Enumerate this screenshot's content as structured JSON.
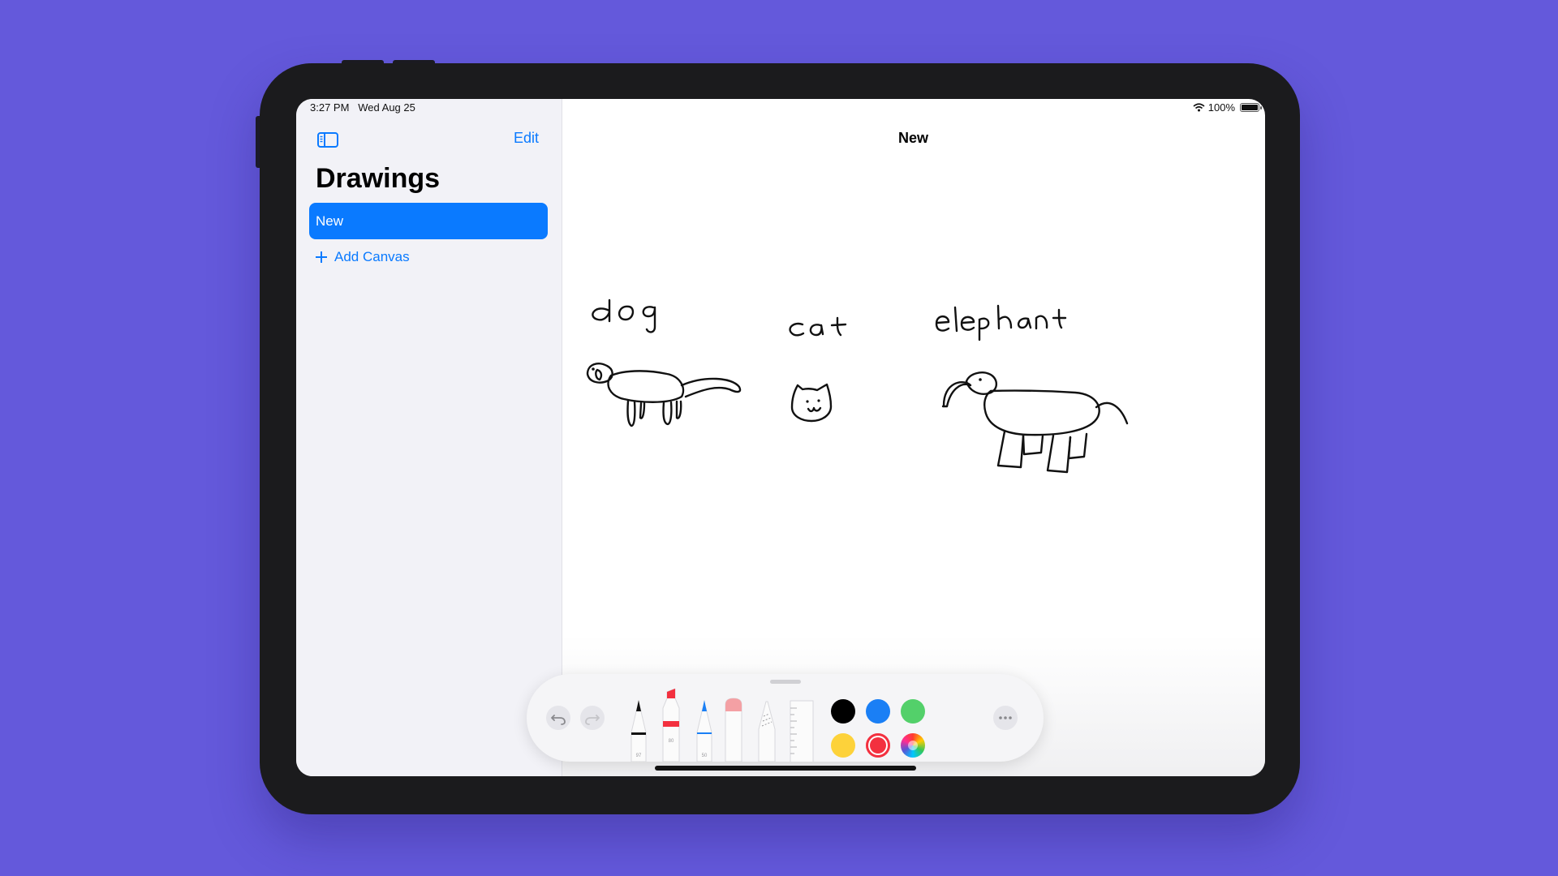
{
  "status_bar": {
    "time": "3:27 PM",
    "date": "Wed Aug 25",
    "battery": "100%"
  },
  "sidebar": {
    "title": "Drawings",
    "edit_label": "Edit",
    "items": [
      {
        "label": "New",
        "selected": true
      }
    ],
    "add_label": "Add Canvas"
  },
  "canvas": {
    "title": "New",
    "drawings": [
      {
        "label": "dog"
      },
      {
        "label": "cat"
      },
      {
        "label": "elephant"
      }
    ]
  },
  "tool_palette": {
    "tools": [
      {
        "name": "pen",
        "size": "97"
      },
      {
        "name": "marker",
        "size": "80"
      },
      {
        "name": "pencil",
        "size": "50"
      },
      {
        "name": "eraser"
      },
      {
        "name": "lasso"
      },
      {
        "name": "ruler"
      }
    ],
    "colors": [
      {
        "name": "black",
        "hex": "#000000"
      },
      {
        "name": "blue",
        "hex": "#1a7ff5"
      },
      {
        "name": "green",
        "hex": "#53d06a"
      },
      {
        "name": "yellow",
        "hex": "#fdd23a"
      },
      {
        "name": "red",
        "hex": "#f3303f",
        "selected": true
      },
      {
        "name": "multicolor",
        "hex": ""
      }
    ]
  },
  "theme": {
    "accent": "#0a7aff",
    "background": "#6459db"
  }
}
